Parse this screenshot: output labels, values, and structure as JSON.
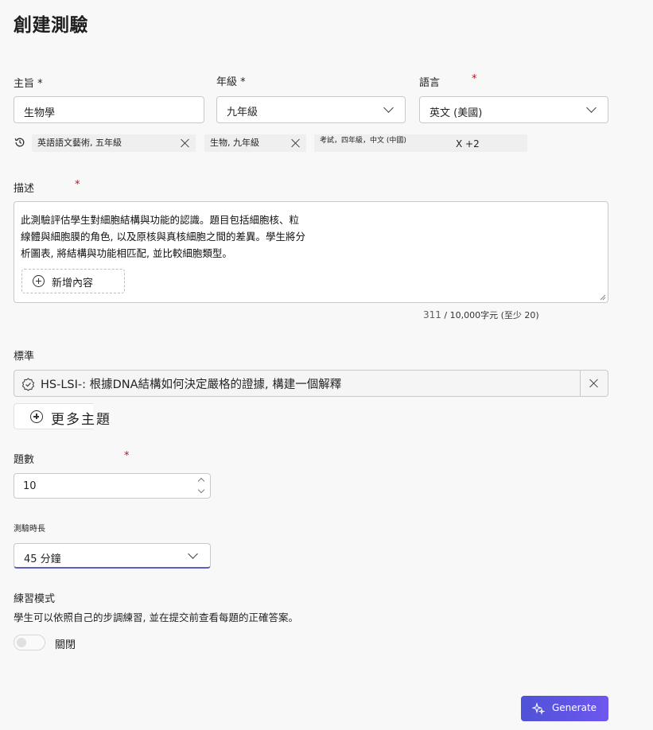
{
  "page": {
    "title": "創建測驗"
  },
  "subject": {
    "label": "主旨",
    "required_mark": "*",
    "value": "生物學"
  },
  "grade": {
    "label": "年級",
    "required_mark": "*",
    "value": "九年級"
  },
  "language": {
    "label": "語言",
    "required_mark": "*",
    "value": "英文 (美國)"
  },
  "recent_chips": [
    {
      "label": "英語語文藝術, 五年級"
    },
    {
      "label": "生物, 九年級"
    },
    {
      "label": "考試，四年級，中文 (中國)",
      "extra": "X +2"
    }
  ],
  "description": {
    "label": "描述",
    "required_mark": "*",
    "lines": [
      "此測驗評估學生對細胞結構與功能的認識。題目包括細胞核、粒",
      "線體與細胞膜的角色, 以及原核與真核細胞之間的差異。學生將分",
      "析圖表, 將結構與功能相匹配, 並比較細胞類型。"
    ],
    "add_content_label": "新增內容",
    "count": "311",
    "count_suffix": " / 10,000字元 (至少 20)"
  },
  "standards": {
    "label": "標準",
    "item": "HS-LSI-: 根據DNA結構如何決定嚴格的證據, 構建一個解釋",
    "more_label": "更多主題"
  },
  "question_count": {
    "label": "題數",
    "required_mark": "*",
    "value": "10"
  },
  "duration": {
    "label": "測驗時長",
    "value": "45 分鐘"
  },
  "practice": {
    "label": "練習模式",
    "description": "學生可以依照自己的步調練習, 並在提交前查看每題的正確答案。",
    "toggle_state": "關閉"
  },
  "generate_button": {
    "label": "Generate"
  },
  "colors": {
    "accent": "#5b5fc7",
    "required": "#c50f1f",
    "button_gradient": "#6e57f0"
  }
}
